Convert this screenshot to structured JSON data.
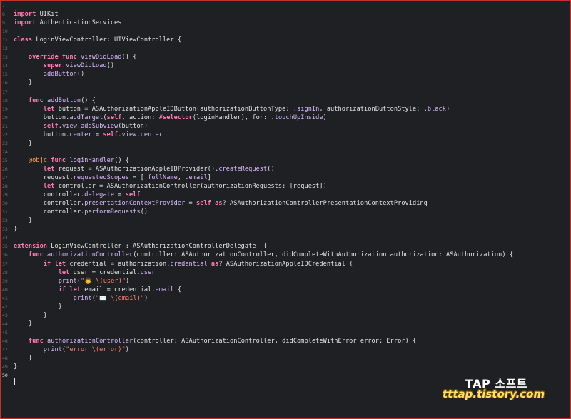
{
  "editor": {
    "lines": [
      {
        "n": "7",
        "t": []
      },
      {
        "n": "8",
        "t": [
          [
            "kw",
            "import"
          ],
          [
            "plain",
            " UIKit"
          ]
        ]
      },
      {
        "n": "9",
        "t": [
          [
            "kw",
            "import"
          ],
          [
            "plain",
            " AuthenticationServices"
          ]
        ]
      },
      {
        "n": "10",
        "t": []
      },
      {
        "n": "11",
        "t": [
          [
            "kw",
            "class"
          ],
          [
            "plain",
            " LoginViewController: UIViewController {"
          ]
        ]
      },
      {
        "n": "12",
        "t": []
      },
      {
        "n": "13",
        "t": [
          [
            "plain",
            "    "
          ],
          [
            "kw",
            "override func"
          ],
          [
            "plain",
            " "
          ],
          [
            "fn",
            "viewDidLoad"
          ],
          [
            "plain",
            "() {"
          ]
        ]
      },
      {
        "n": "14",
        "t": [
          [
            "plain",
            "        "
          ],
          [
            "kw",
            "super"
          ],
          [
            "plain",
            "."
          ],
          [
            "fn",
            "viewDidLoad"
          ],
          [
            "plain",
            "()"
          ]
        ]
      },
      {
        "n": "15",
        "t": [
          [
            "plain",
            "        "
          ],
          [
            "fn",
            "addButton"
          ],
          [
            "plain",
            "()"
          ]
        ]
      },
      {
        "n": "16",
        "t": [
          [
            "plain",
            "    }"
          ]
        ]
      },
      {
        "n": "17",
        "t": []
      },
      {
        "n": "18",
        "t": [
          [
            "plain",
            "    "
          ],
          [
            "kw",
            "func"
          ],
          [
            "plain",
            " "
          ],
          [
            "fn",
            "addButton"
          ],
          [
            "plain",
            "() {"
          ]
        ]
      },
      {
        "n": "19",
        "t": [
          [
            "plain",
            "        "
          ],
          [
            "kw",
            "let"
          ],
          [
            "plain",
            " button = ASAuthorizationAppleIDButton(authorizationButtonType: ."
          ],
          [
            "pr",
            "signIn"
          ],
          [
            "plain",
            ", authorizationButtonStyle: ."
          ],
          [
            "pr",
            "black"
          ],
          [
            "plain",
            ")"
          ]
        ]
      },
      {
        "n": "20",
        "t": [
          [
            "plain",
            "        button."
          ],
          [
            "fn",
            "addTarget"
          ],
          [
            "plain",
            "("
          ],
          [
            "kw",
            "self"
          ],
          [
            "plain",
            ", action: "
          ],
          [
            "kw",
            "#selector"
          ],
          [
            "plain",
            "(loginHandler), for: ."
          ],
          [
            "pr",
            "touchUpInside"
          ],
          [
            "plain",
            ")"
          ]
        ]
      },
      {
        "n": "21",
        "t": [
          [
            "plain",
            "        "
          ],
          [
            "kw",
            "self"
          ],
          [
            "plain",
            "."
          ],
          [
            "pr",
            "view"
          ],
          [
            "plain",
            "."
          ],
          [
            "fn",
            "addSubview"
          ],
          [
            "plain",
            "(button)"
          ]
        ]
      },
      {
        "n": "22",
        "t": [
          [
            "plain",
            "        button."
          ],
          [
            "pr",
            "center"
          ],
          [
            "plain",
            " = "
          ],
          [
            "kw",
            "self"
          ],
          [
            "plain",
            "."
          ],
          [
            "pr",
            "view"
          ],
          [
            "plain",
            "."
          ],
          [
            "pr",
            "center"
          ]
        ]
      },
      {
        "n": "23",
        "t": [
          [
            "plain",
            "    }"
          ]
        ]
      },
      {
        "n": "24",
        "t": []
      },
      {
        "n": "25",
        "t": [
          [
            "plain",
            "    "
          ],
          [
            "at",
            "@objc"
          ],
          [
            "plain",
            " "
          ],
          [
            "kw",
            "func"
          ],
          [
            "plain",
            " "
          ],
          [
            "fn",
            "loginHandler"
          ],
          [
            "plain",
            "() {"
          ]
        ]
      },
      {
        "n": "26",
        "t": [
          [
            "plain",
            "        "
          ],
          [
            "kw",
            "let"
          ],
          [
            "plain",
            " request = ASAuthorizationAppleIDProvider()."
          ],
          [
            "fn",
            "createRequest"
          ],
          [
            "plain",
            "()"
          ]
        ]
      },
      {
        "n": "27",
        "t": [
          [
            "plain",
            "        request."
          ],
          [
            "pr",
            "requestedScopes"
          ],
          [
            "plain",
            " = [."
          ],
          [
            "pr",
            "fullName"
          ],
          [
            "plain",
            ", ."
          ],
          [
            "pr",
            "email"
          ],
          [
            "plain",
            "]"
          ]
        ]
      },
      {
        "n": "28",
        "t": [
          [
            "plain",
            "        "
          ],
          [
            "kw",
            "let"
          ],
          [
            "plain",
            " controller = ASAuthorizationController(authorizationRequests: [request])"
          ]
        ]
      },
      {
        "n": "29",
        "t": [
          [
            "plain",
            "        controller."
          ],
          [
            "pr",
            "delegate"
          ],
          [
            "plain",
            " = "
          ],
          [
            "kw",
            "self"
          ]
        ]
      },
      {
        "n": "30",
        "t": [
          [
            "plain",
            "        controller."
          ],
          [
            "pr",
            "presentationContextProvider"
          ],
          [
            "plain",
            " = "
          ],
          [
            "kw",
            "self"
          ],
          [
            "plain",
            " "
          ],
          [
            "kw",
            "as"
          ],
          [
            "plain",
            "? ASAuthorizationControllerPresentationContextProviding"
          ]
        ]
      },
      {
        "n": "31",
        "t": [
          [
            "plain",
            "        controller."
          ],
          [
            "fn",
            "performRequests"
          ],
          [
            "plain",
            "()"
          ]
        ]
      },
      {
        "n": "32",
        "t": [
          [
            "plain",
            "    }"
          ]
        ]
      },
      {
        "n": "33",
        "t": [
          [
            "plain",
            "}"
          ]
        ]
      },
      {
        "n": "34",
        "t": []
      },
      {
        "n": "35",
        "t": [
          [
            "kw",
            "extension"
          ],
          [
            "plain",
            " LoginViewController : ASAuthorizationControllerDelegate  {"
          ]
        ]
      },
      {
        "n": "36",
        "t": [
          [
            "plain",
            "    "
          ],
          [
            "kw",
            "func"
          ],
          [
            "plain",
            " "
          ],
          [
            "fn",
            "authorizationController"
          ],
          [
            "plain",
            "(controller: ASAuthorizationController, didCompleteWithAuthorization authorization: ASAuthorization) {"
          ]
        ]
      },
      {
        "n": "37",
        "t": [
          [
            "plain",
            "        "
          ],
          [
            "kw",
            "if let"
          ],
          [
            "plain",
            " credential = authorization."
          ],
          [
            "pr",
            "credential"
          ],
          [
            "plain",
            " "
          ],
          [
            "kw",
            "as"
          ],
          [
            "plain",
            "? ASAuthorizationAppleIDCredential {"
          ]
        ]
      },
      {
        "n": "38",
        "t": [
          [
            "plain",
            "            "
          ],
          [
            "kw",
            "let"
          ],
          [
            "plain",
            " user = credential."
          ],
          [
            "pr",
            "user"
          ]
        ]
      },
      {
        "n": "39",
        "t": [
          [
            "plain",
            "            "
          ],
          [
            "fn",
            "print"
          ],
          [
            "plain",
            "("
          ],
          [
            "st",
            "\"👨 \\(user)\""
          ],
          [
            "plain",
            ")"
          ]
        ]
      },
      {
        "n": "40",
        "t": [
          [
            "plain",
            "            "
          ],
          [
            "kw",
            "if let"
          ],
          [
            "plain",
            " email = credential."
          ],
          [
            "pr",
            "email"
          ],
          [
            "plain",
            " {"
          ]
        ]
      },
      {
        "n": "41",
        "t": [
          [
            "plain",
            "                "
          ],
          [
            "fn",
            "print"
          ],
          [
            "plain",
            "("
          ],
          [
            "st",
            "\"✉️ \\(email)\""
          ],
          [
            "plain",
            ")"
          ]
        ]
      },
      {
        "n": "42",
        "t": [
          [
            "plain",
            "            }"
          ]
        ]
      },
      {
        "n": "43",
        "t": [
          [
            "plain",
            "        }"
          ]
        ]
      },
      {
        "n": "44",
        "t": [
          [
            "plain",
            "    }"
          ]
        ]
      },
      {
        "n": "45",
        "t": []
      },
      {
        "n": "46",
        "t": [
          [
            "plain",
            "    "
          ],
          [
            "kw",
            "func"
          ],
          [
            "plain",
            " "
          ],
          [
            "fn",
            "authorizationController"
          ],
          [
            "plain",
            "(controller: ASAuthorizationController, didCompleteWithError error: Error) {"
          ]
        ]
      },
      {
        "n": "47",
        "t": [
          [
            "plain",
            "        "
          ],
          [
            "fn",
            "print"
          ],
          [
            "plain",
            "("
          ],
          [
            "st",
            "\"error \\(error)\""
          ],
          [
            "plain",
            ")"
          ]
        ]
      },
      {
        "n": "48",
        "t": [
          [
            "plain",
            "    }"
          ]
        ]
      },
      {
        "n": "49",
        "t": [
          [
            "plain",
            "}"
          ]
        ]
      },
      {
        "n": "50",
        "t": [],
        "current": true
      }
    ]
  },
  "watermark": {
    "line1": "TAP 소프트",
    "line2": "tttap.tistory.com"
  },
  "colors": {
    "background": "#1f2024",
    "keyword": "#ff7ab2",
    "type": "#dabaff",
    "string": "#ff8170",
    "attribute": "#ffa14f",
    "border": "#c0342b"
  }
}
